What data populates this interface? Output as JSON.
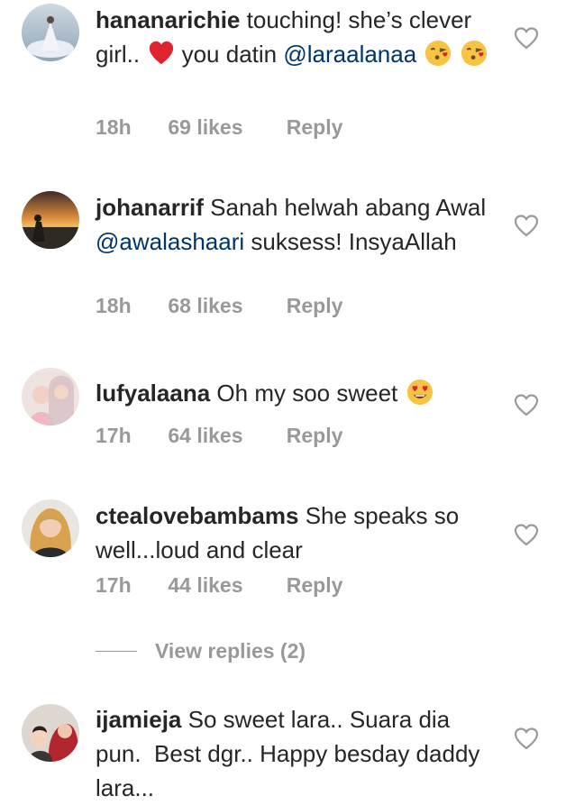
{
  "comments": [
    {
      "username": "hananarichie",
      "text_1": "touching! she’s clever girl..",
      "text_2": "you datin",
      "mention": "@laraalanaa",
      "emoji": [
        "red-heart",
        "face-blowing-kiss",
        "face-blowing-kiss"
      ],
      "time": "18h",
      "likes": "69 likes",
      "reply": "Reply"
    },
    {
      "username": "johanarrif",
      "text_1": "Sanah helwah abang Awal",
      "mention": "@awalashaari",
      "text_2": "suksess! InsyaAllah",
      "time": "18h",
      "likes": "68 likes",
      "reply": "Reply"
    },
    {
      "username": "lufyalaana",
      "text_1": "Oh my soo sweet",
      "emoji": [
        "heart-eyes-face"
      ],
      "time": "17h",
      "likes": "64 likes",
      "reply": "Reply"
    },
    {
      "username": "ctealovebambams",
      "text_1": "She speaks so well...loud and clear",
      "time": "17h",
      "likes": "44 likes",
      "reply": "Reply"
    },
    {
      "username": "ijamieja",
      "text_1": "So sweet lara.. Suara dia pun.  Best dgr.. Happy besday daddy lara..."
    }
  ],
  "view_replies": "View replies (2)",
  "colors": {
    "text": "#262626",
    "meta": "#999999",
    "mention": "#003569"
  }
}
